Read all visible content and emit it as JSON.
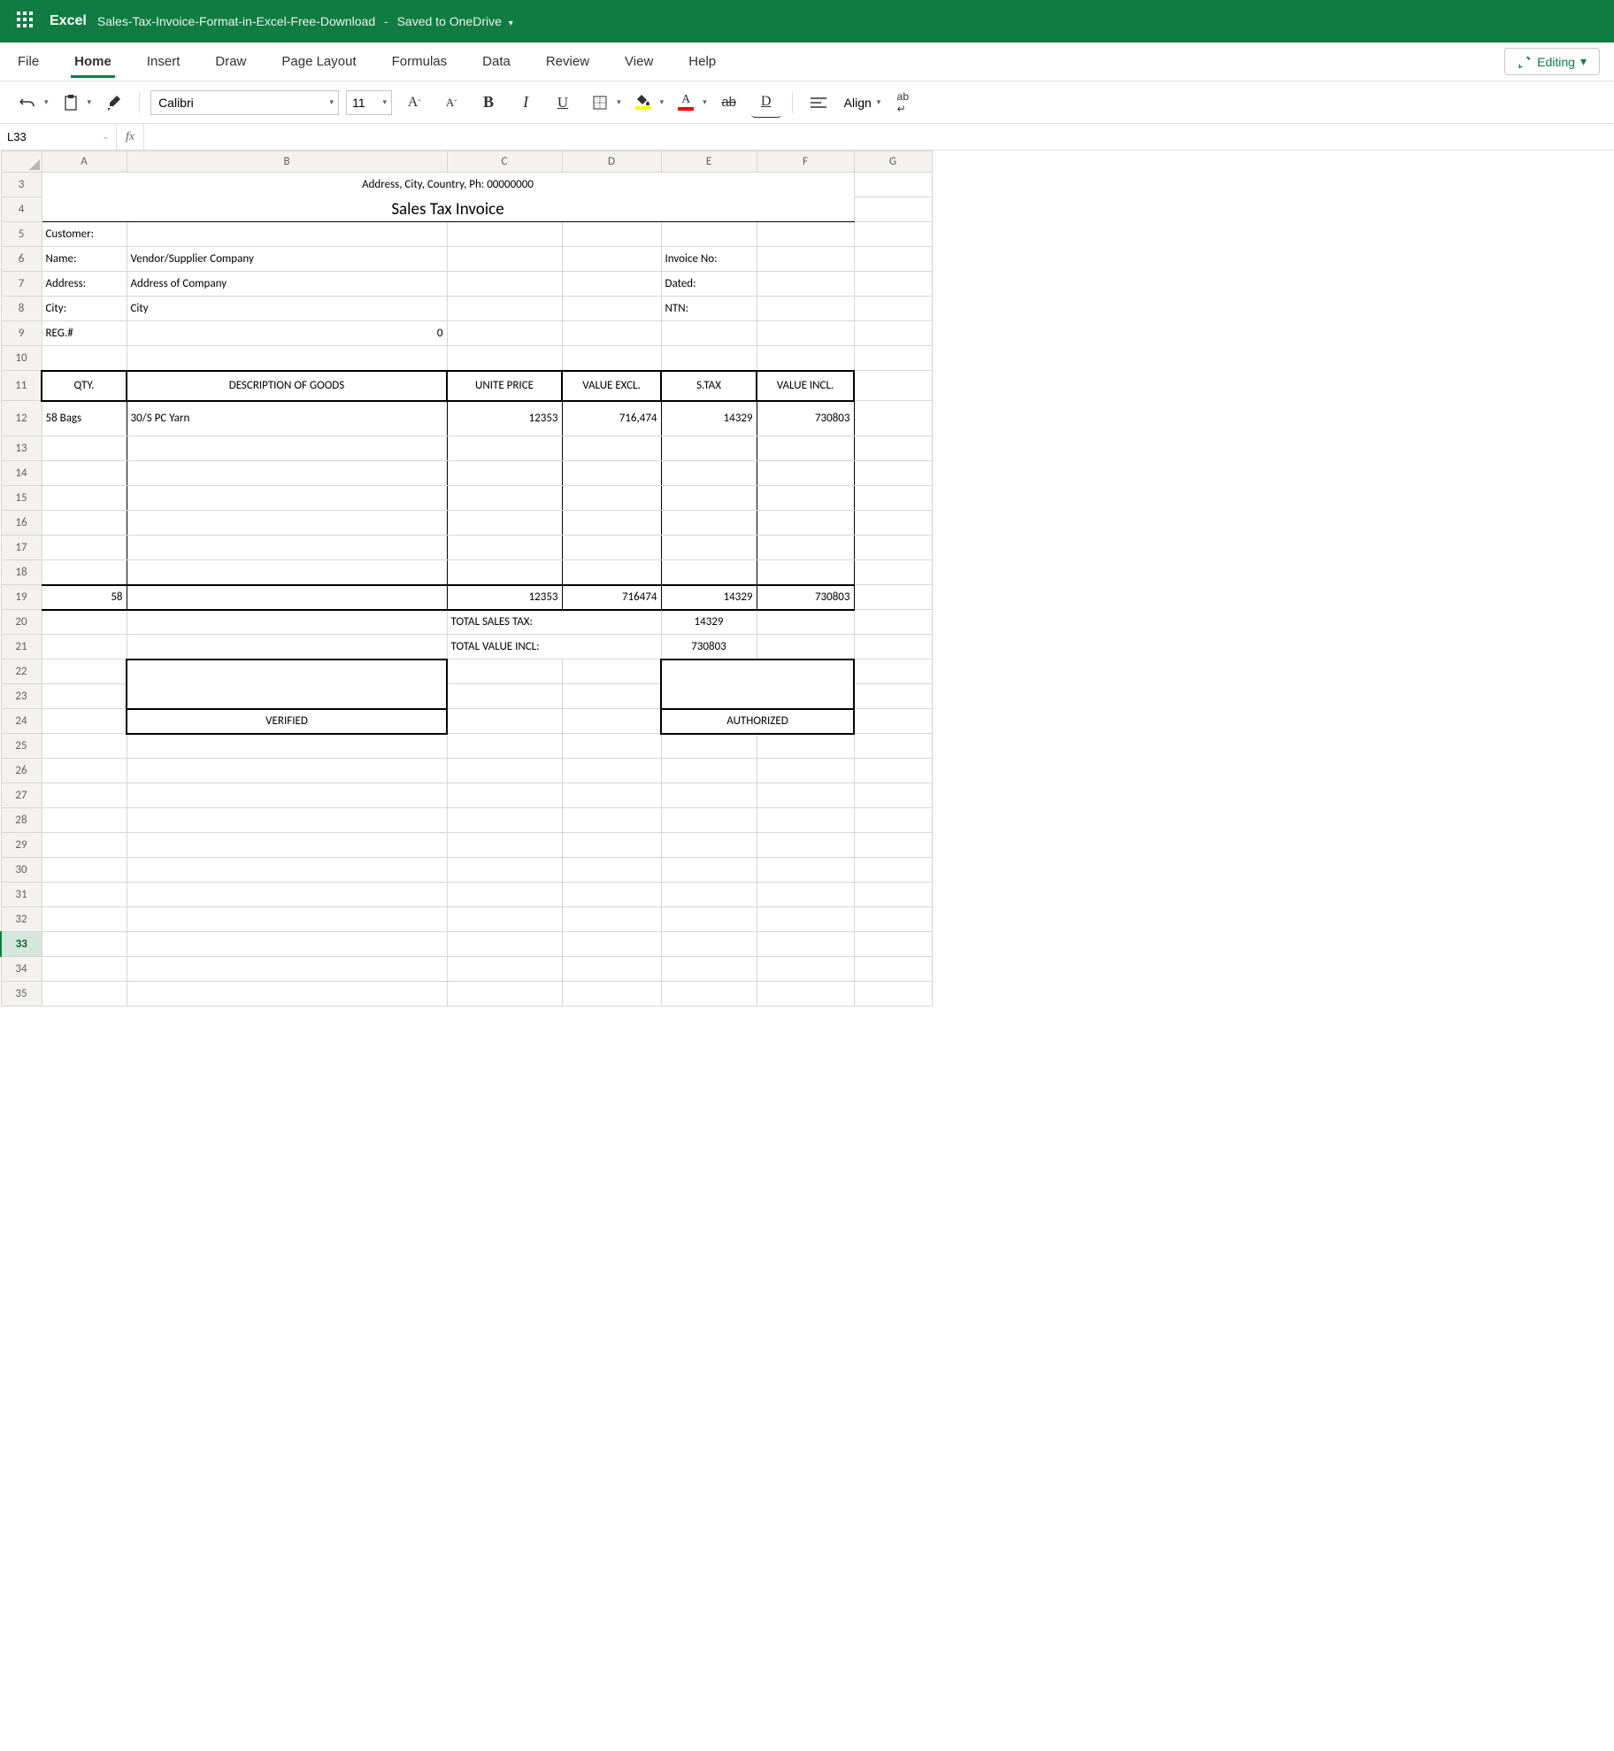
{
  "titlebar": {
    "app": "Excel",
    "doc": "Sales-Tax-Invoice-Format-in-Excel-Free-Download",
    "saved": "Saved to OneDrive"
  },
  "ribbon": {
    "tabs": [
      "File",
      "Home",
      "Insert",
      "Draw",
      "Page Layout",
      "Formulas",
      "Data",
      "Review",
      "View",
      "Help"
    ],
    "active": "Home",
    "editing": "Editing"
  },
  "toolbar": {
    "font": "Calibri",
    "size": "11",
    "align": "Align"
  },
  "formula": {
    "cellref": "L33",
    "value": ""
  },
  "columns": [
    "A",
    "B",
    "C",
    "D",
    "E",
    "F",
    "G"
  ],
  "rows_start": 3,
  "rows_end": 35,
  "active_row": 33,
  "invoice": {
    "header_line": "Address, City, Country, Ph: 00000000",
    "title": "Sales Tax Invoice",
    "customer_label": "Customer:",
    "name_label": "Name:",
    "name_value": "Vendor/Supplier Company",
    "address_label": "Address:",
    "address_value": "Address of Company",
    "city_label": "City:",
    "city_value": "City",
    "reg_label": "REG.#",
    "reg_value": "0",
    "invno_label": "Invoice No:",
    "dated_label": "Dated:",
    "ntn_label": "NTN:",
    "cols": {
      "qty": "QTY.",
      "desc": "DESCRIPTION OF GOODS",
      "unit": "UNITE PRICE",
      "excl": "VALUE EXCL.",
      "stax": "S.TAX",
      "incl": "VALUE INCL."
    },
    "line1": {
      "qty": "58 Bags",
      "desc": "30/S PC Yarn",
      "unit": "12353",
      "excl": "716,474",
      "stax": "14329",
      "incl": "730803"
    },
    "totals_row": {
      "qty": "58",
      "unit": "12353",
      "excl": "716474",
      "stax": "14329",
      "incl": "730803"
    },
    "total_tax_label": "TOTAL SALES TAX:",
    "total_tax_value": "14329",
    "total_incl_label": "TOTAL VALUE INCL:",
    "total_incl_value": "730803",
    "verified": "VERIFIED",
    "authorized": "AUTHORIZED"
  }
}
